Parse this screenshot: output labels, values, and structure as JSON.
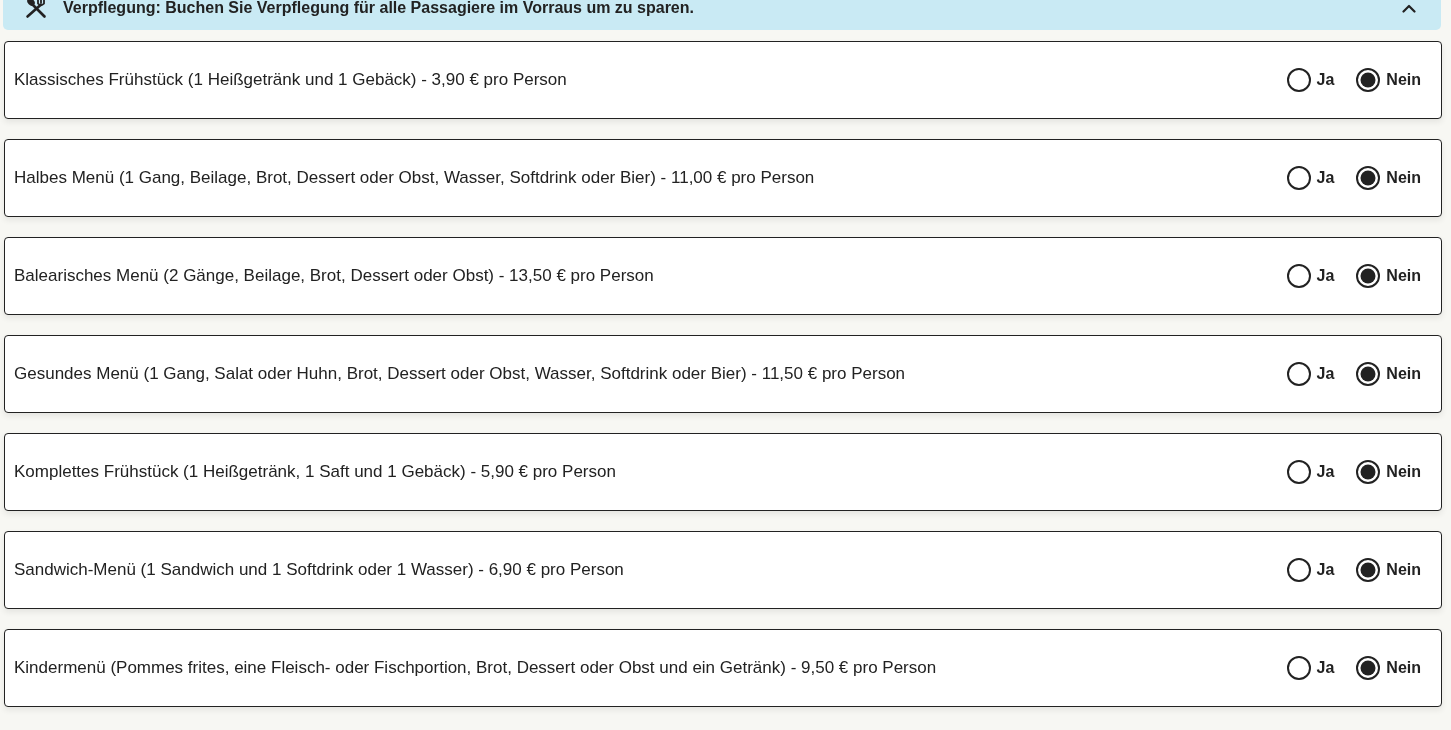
{
  "banner": {
    "title": "Verpflegung: Buchen Sie Verpflegung für alle Passagiere im Vorraus um zu sparen.",
    "expanded": true
  },
  "options": [
    {
      "label": "Klassisches Frühstück (1 Heißgetränk und 1 Gebäck) - 3,90 € pro Person",
      "choices": [
        {
          "label": "Ja",
          "selected": false
        },
        {
          "label": "Nein",
          "selected": true
        }
      ]
    },
    {
      "label": "Halbes Menü (1 Gang, Beilage, Brot, Dessert oder Obst, Wasser, Softdrink oder Bier) - 11,00 € pro Person",
      "choices": [
        {
          "label": "Ja",
          "selected": false
        },
        {
          "label": "Nein",
          "selected": true
        }
      ]
    },
    {
      "label": "Balearisches Menü (2 Gänge, Beilage, Brot, Dessert oder Obst) - 13,50 € pro Person",
      "choices": [
        {
          "label": "Ja",
          "selected": false
        },
        {
          "label": "Nein",
          "selected": true
        }
      ]
    },
    {
      "label": "Gesundes Menü (1 Gang, Salat oder Huhn, Brot, Dessert oder Obst, Wasser, Softdrink oder Bier) - 11,50 € pro Person",
      "choices": [
        {
          "label": "Ja",
          "selected": false
        },
        {
          "label": "Nein",
          "selected": true
        }
      ]
    },
    {
      "label": "Komplettes Frühstück (1 Heißgetränk, 1 Saft und 1 Gebäck) - 5,90 € pro Person",
      "choices": [
        {
          "label": "Ja",
          "selected": false
        },
        {
          "label": "Nein",
          "selected": true
        }
      ]
    },
    {
      "label": "Sandwich-Menü (1 Sandwich und 1 Softdrink oder 1 Wasser) - 6,90 € pro Person",
      "choices": [
        {
          "label": "Ja",
          "selected": false
        },
        {
          "label": "Nein",
          "selected": true
        }
      ]
    },
    {
      "label": "Kindermenü (Pommes frites, eine Fleisch- oder Fischportion, Brot, Dessert oder Obst und ein Getränk) - 9,50 € pro Person",
      "choices": [
        {
          "label": "Ja",
          "selected": false
        },
        {
          "label": "Nein",
          "selected": true
        }
      ]
    }
  ]
}
